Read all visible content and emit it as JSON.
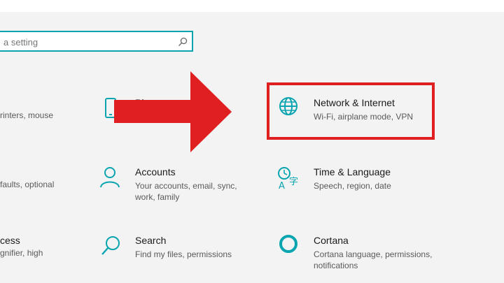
{
  "search": {
    "placeholder_visible": "a setting"
  },
  "left_column": {
    "devices_desc": "rinters, mouse",
    "apps_desc": "faults, optional",
    "ease_title": "cess",
    "ease_desc": "gnifier, high"
  },
  "tiles": {
    "phone": {
      "title": "Phone"
    },
    "network": {
      "title": "Network & Internet",
      "desc": "Wi-Fi, airplane mode, VPN"
    },
    "accounts": {
      "title": "Accounts",
      "desc_line1": "Your accounts, email, sync,",
      "desc_line2": "work, family"
    },
    "time": {
      "title": "Time & Language",
      "desc": "Speech, region, date"
    },
    "search": {
      "title": "Search",
      "desc": "Find my files, permissions"
    },
    "cortana": {
      "title": "Cortana",
      "desc_line1": "Cortana language, permissions,",
      "desc_line2": "notifications"
    }
  },
  "colors": {
    "accent": "#0aa5b0",
    "annotation_red": "#e02020"
  }
}
